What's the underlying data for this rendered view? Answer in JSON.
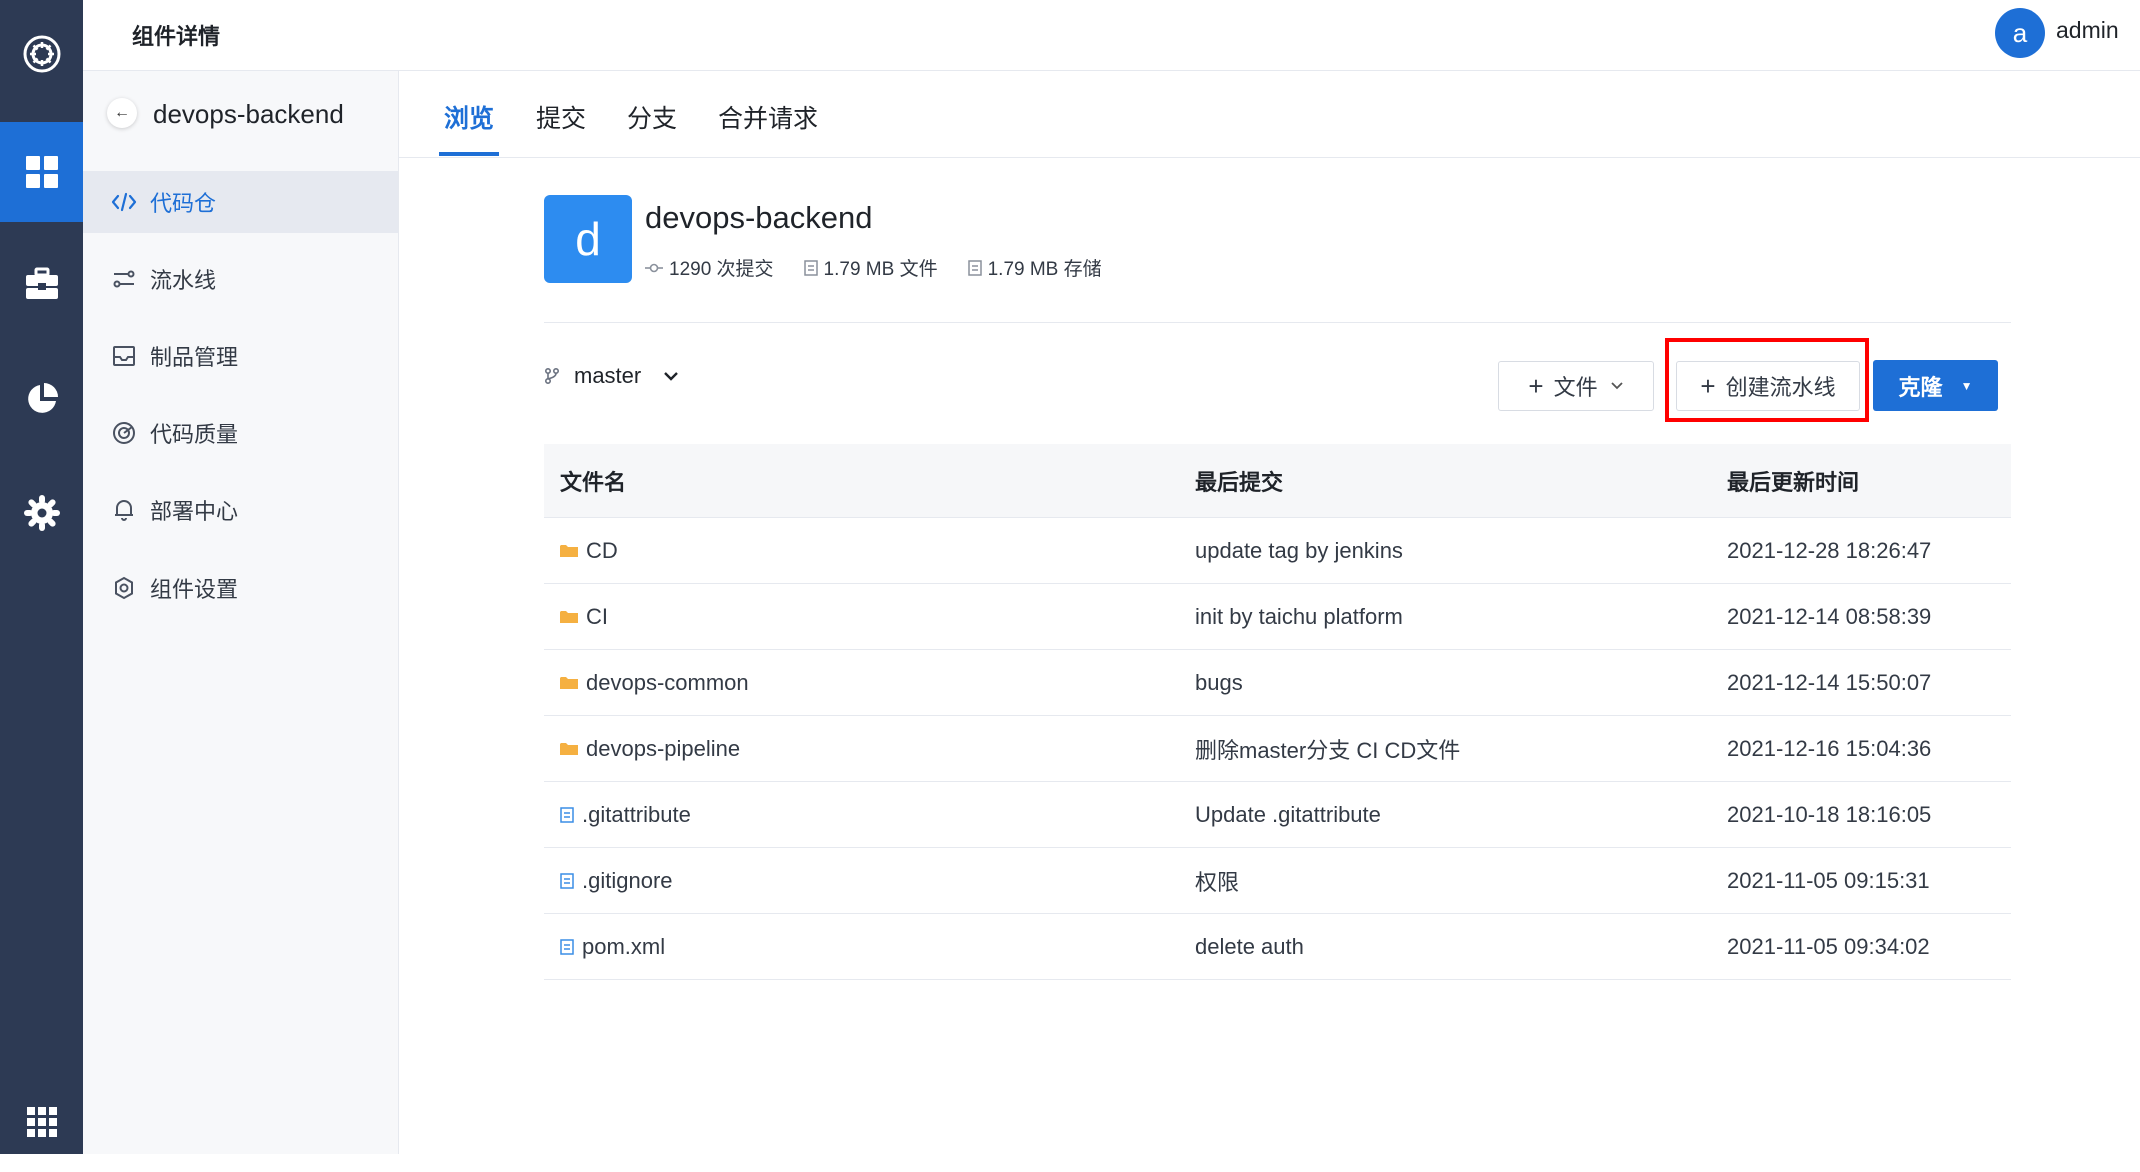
{
  "header": {
    "title": "组件详情",
    "avatar_letter": "a",
    "username": "admin"
  },
  "rail": {
    "items": [
      "logo-icon",
      "dashboard-icon",
      "toolbox-icon",
      "chart-pie-icon",
      "settings-icon",
      "apps-grid-icon"
    ]
  },
  "sidebar": {
    "repo_name": "devops-backend",
    "items": [
      {
        "label": "代码仓",
        "icon": "code-icon",
        "active": true
      },
      {
        "label": "流水线",
        "icon": "pipeline-icon"
      },
      {
        "label": "制品管理",
        "icon": "inbox-icon"
      },
      {
        "label": "代码质量",
        "icon": "quality-icon"
      },
      {
        "label": "部署中心",
        "icon": "bell-icon"
      },
      {
        "label": "组件设置",
        "icon": "gear-icon"
      }
    ]
  },
  "tabs": [
    "浏览",
    "提交",
    "分支",
    "合并请求"
  ],
  "repo": {
    "avatar_letter": "d",
    "name": "devops-backend",
    "stats": {
      "commits": "1290 次提交",
      "files": "1.79 MB 文件",
      "storage": "1.79 MB 存储"
    }
  },
  "toolbar": {
    "branch": "master",
    "file_button": "文件",
    "pipeline_button": "创建流水线",
    "clone_button": "克隆"
  },
  "table": {
    "headers": [
      "文件名",
      "最后提交",
      "最后更新时间"
    ],
    "rows": [
      {
        "type": "folder",
        "name": "CD",
        "commit": "update tag by jenkins",
        "time": "2021-12-28 18:26:47"
      },
      {
        "type": "folder",
        "name": "CI",
        "commit": "init by taichu platform",
        "time": "2021-12-14 08:58:39"
      },
      {
        "type": "folder",
        "name": "devops-common",
        "commit": "bugs",
        "time": "2021-12-14 15:50:07"
      },
      {
        "type": "folder",
        "name": "devops-pipeline",
        "commit": "删除master分支 CI CD文件",
        "time": "2021-12-16 15:04:36"
      },
      {
        "type": "file",
        "name": ".gitattribute",
        "commit": "Update .gitattribute",
        "time": "2021-10-18 18:16:05"
      },
      {
        "type": "file",
        "name": ".gitignore",
        "commit": "权限",
        "time": "2021-11-05 09:15:31"
      },
      {
        "type": "file",
        "name": "pom.xml",
        "commit": "delete auth",
        "time": "2021-11-05 09:34:02"
      }
    ]
  },
  "colors": {
    "primary": "#1e6fd6",
    "rail": "#2d3a54",
    "folder": "#f5b041",
    "highlight": "#ff0000"
  }
}
